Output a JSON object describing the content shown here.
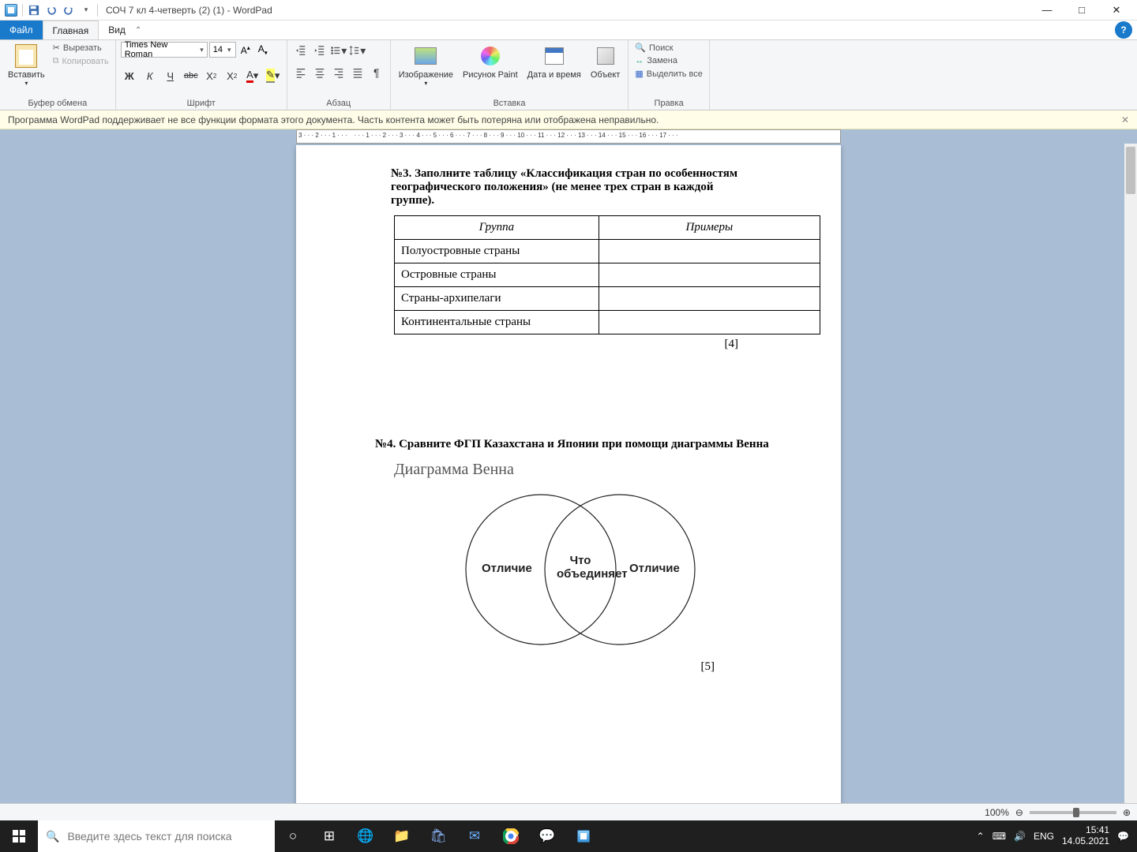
{
  "title": "СОЧ 7 кл 4-четверть (2) (1) - WordPad",
  "tabs": {
    "file": "Файл",
    "home": "Главная",
    "view": "Вид"
  },
  "clipboard": {
    "paste": "Вставить",
    "cut": "Вырезать",
    "copy": "Копировать",
    "group": "Буфер обмена"
  },
  "font": {
    "family": "Times New Roman",
    "size": "14",
    "group": "Шрифт"
  },
  "paragraph": {
    "group": "Абзац"
  },
  "insert": {
    "image": "Изображение",
    "paint": "Рисунок Paint",
    "datetime": "Дата и время",
    "object": "Объект",
    "group": "Вставка"
  },
  "editing": {
    "find": "Поиск",
    "replace": "Замена",
    "selectall": "Выделить все",
    "group": "Правка"
  },
  "warning": "Программа WordPad поддерживает не все функции формата этого документа. Часть контента может быть потеряна или отображена неправильно.",
  "doc": {
    "q3_title": "№3. Заполните таблицу «Классификация стран по особенностям географического положения» (не менее трех стран в каждой группе).",
    "table_h1": "Группа",
    "table_h2": "Примеры",
    "row1": "Полуостровные страны",
    "row2": "Островные страны",
    "row3": "Страны-архипелаги",
    "row4": "Континентальные страны",
    "score3": "[4]",
    "q4_title": "№4. Сравните ФГП Казахстана и Японии при помощи диаграммы Венна",
    "venn_heading": "Диаграмма Венна",
    "venn_left": "Отличие",
    "venn_mid1": "Что",
    "venn_mid2": "объединяет",
    "venn_right": "Отличие",
    "score4": "[5]"
  },
  "status": {
    "zoom": "100%"
  },
  "taskbar": {
    "search_placeholder": "Введите здесь текст для поиска",
    "lang": "ENG",
    "time": "15:41",
    "date": "14.05.2021"
  }
}
